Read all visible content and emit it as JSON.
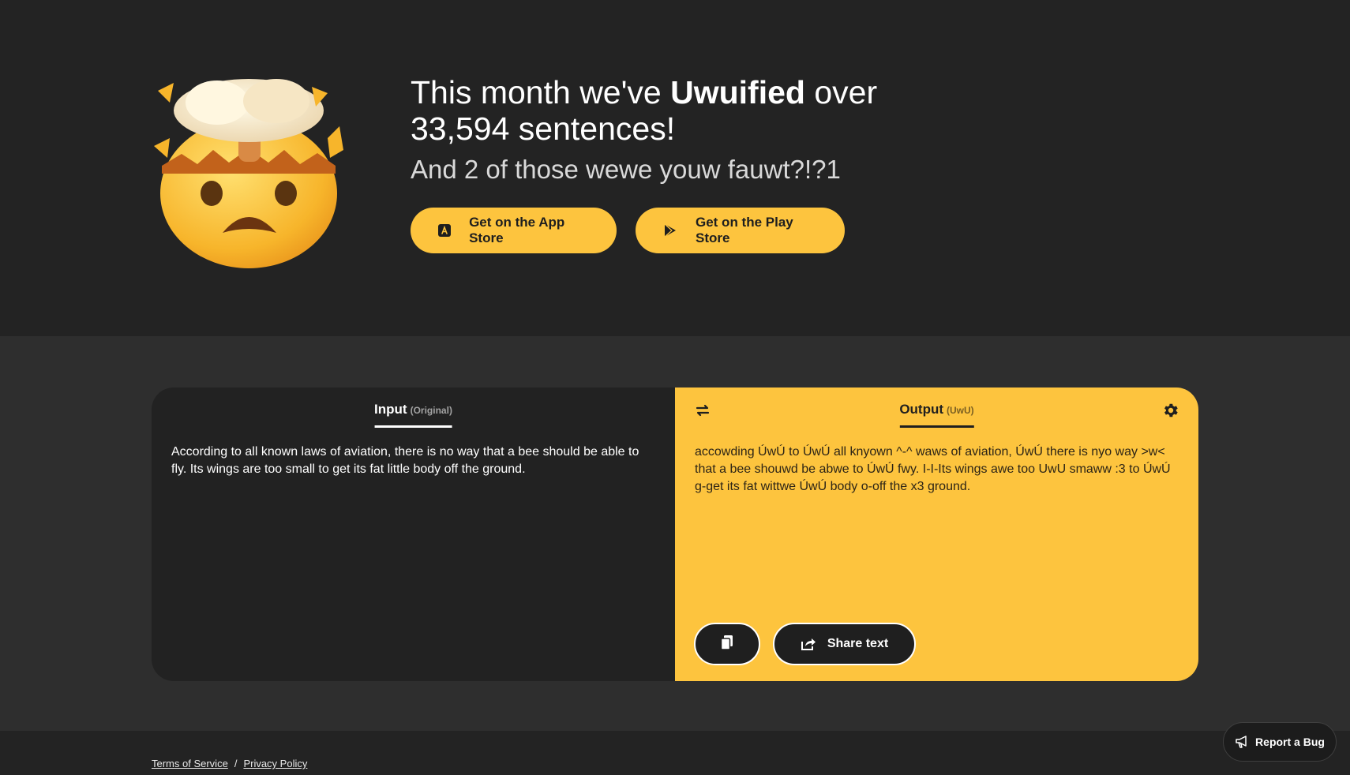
{
  "hero": {
    "headline_prefix": "This month we've ",
    "headline_bold": "Uwuified",
    "headline_suffix": " over 33,594 sentences!",
    "subline": "And 2 of those wewe youw fauwt?!?1",
    "app_store_label": "Get on the App Store",
    "play_store_label": "Get on the Play Store",
    "emoji_icon": "exploding-head-icon"
  },
  "translator": {
    "input_tab": "Input",
    "input_tab_note": "(Original)",
    "input_text": "According to all known laws of aviation, there is no way that a bee should be able to fly. Its wings are too small to get its fat little body off the ground.",
    "output_tab": "Output",
    "output_tab_note": "(UwU)",
    "output_text": "accowding ÚwÚ to ÚwÚ all knyown ^-^ waws of aviation, ÚwÚ there is nyo way >w< that a bee shouwd be abwe to ÚwÚ fwy. I-I-Its wings awe too UwU smaww :3 to ÚwÚ g-get its fat wittwe ÚwÚ body o-off the x3 ground.",
    "share_label": "Share text",
    "accent_color": "#fdc43e"
  },
  "footer": {
    "terms": "Terms of Service",
    "separator": "/",
    "privacy": "Privacy Policy"
  },
  "bug_report": {
    "label": "Report a Bug"
  }
}
